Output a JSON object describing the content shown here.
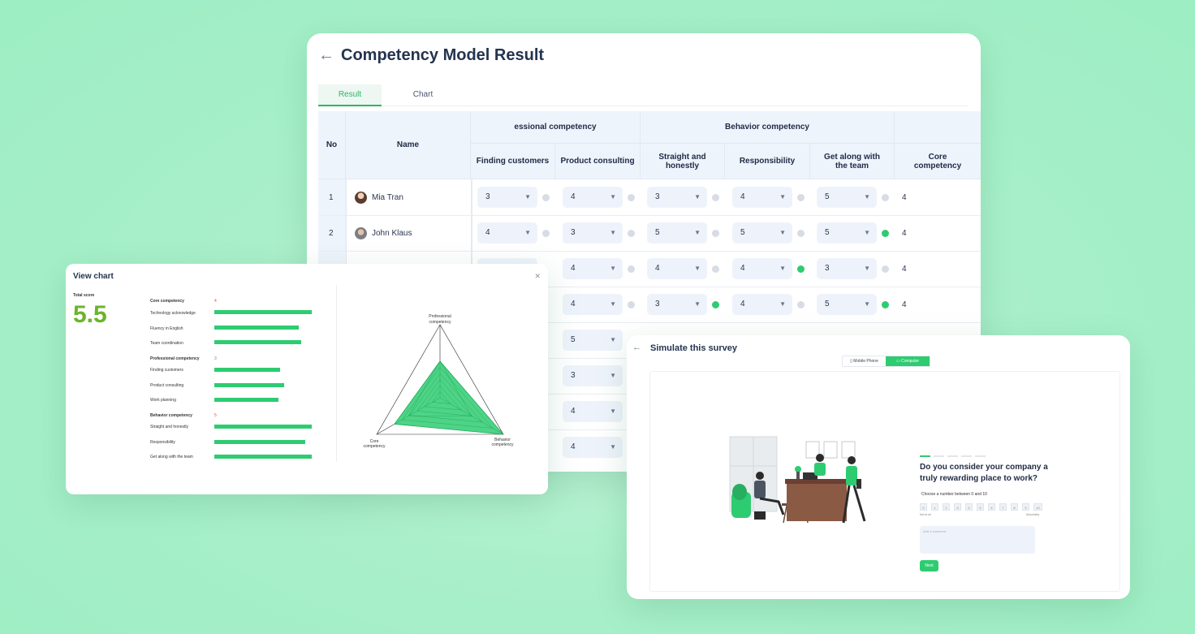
{
  "main": {
    "back_icon": "arrow-left-icon",
    "title": "Competency Model Result",
    "tabs": [
      {
        "label": "Result",
        "active": true
      },
      {
        "label": "Chart",
        "active": false
      }
    ],
    "headers": {
      "no": "No",
      "name": "Name",
      "group_professional": "essional competency",
      "group_behavior": "Behavior competency",
      "finding_customers": "Finding customers",
      "product_consulting": "Product consulting",
      "straight_honestly": "Straight and honestly",
      "responsibility": "Responsibility",
      "get_along": "Get along with the team",
      "core": "Core competency"
    },
    "rows": [
      {
        "no": "1",
        "name": "Mia Tran",
        "finding": "3",
        "consulting": "4",
        "straight": "3",
        "responsibility": "4",
        "get_along": "5",
        "core": "4"
      },
      {
        "no": "2",
        "name": "John Klaus",
        "finding": "4",
        "consulting": "3",
        "straight": "5",
        "responsibility": "5",
        "get_along": "5",
        "core": "4"
      },
      {
        "consulting": "4",
        "straight": "4",
        "responsibility": "4",
        "get_along": "3",
        "core": "4"
      },
      {
        "consulting": "4",
        "straight": "3",
        "responsibility": "4",
        "get_along": "5",
        "core": "4"
      },
      {
        "consulting": "5"
      },
      {
        "consulting": "3"
      },
      {
        "consulting": "4"
      },
      {
        "consulting": "4"
      }
    ]
  },
  "chart_card": {
    "title": "View chart",
    "close_icon": "close-icon",
    "total_score_label": "Total score",
    "total_score": "5.5",
    "groups": [
      {
        "name": "Core competency",
        "score": "4",
        "score_color": "#e74c3c",
        "items": [
          {
            "label": "Technology acknowledge",
            "value": 0.92
          },
          {
            "label": "Fluency in English",
            "value": 0.8
          },
          {
            "label": "Team coordination",
            "value": 0.82
          }
        ]
      },
      {
        "name": "Professional competency",
        "score": "3",
        "score_color": "#7a8090",
        "items": [
          {
            "label": "Finding customers",
            "value": 0.62
          },
          {
            "label": "Product consulting",
            "value": 0.66
          },
          {
            "label": "Work planning",
            "value": 0.61
          }
        ]
      },
      {
        "name": "Behavior competency",
        "score": "5",
        "score_color": "#e74c3c",
        "items": [
          {
            "label": "Straight and honestly",
            "value": 0.92
          },
          {
            "label": "Responsibility",
            "value": 0.86
          },
          {
            "label": "Get along with the team",
            "value": 0.92
          }
        ]
      }
    ],
    "radar": {
      "axis_top_1": "Professional",
      "axis_top_2": "competency",
      "axis_left_1": "Core",
      "axis_left_2": "competency",
      "axis_right_1": "Behavior",
      "axis_right_2": "competency",
      "values": [
        0.5,
        0.72,
        1.0
      ]
    }
  },
  "survey": {
    "back_icon": "arrow-left-icon",
    "title": "Simulate this survey",
    "toggle": {
      "mobile": "Mobile Phone",
      "computer": "Computer",
      "active": "computer"
    },
    "question": "Do you consider your company a truly rewarding place to work?",
    "instruction": "Choose a number between 0 and 10",
    "numbers": [
      "0",
      "1",
      "2",
      "3",
      "4",
      "5",
      "6",
      "7",
      "8",
      "9",
      "10"
    ],
    "low_label": "Not at all",
    "high_label": "Absolutely",
    "comment_placeholder": "Add a comment",
    "next_label": "Next",
    "accent": "#2ecc71"
  }
}
